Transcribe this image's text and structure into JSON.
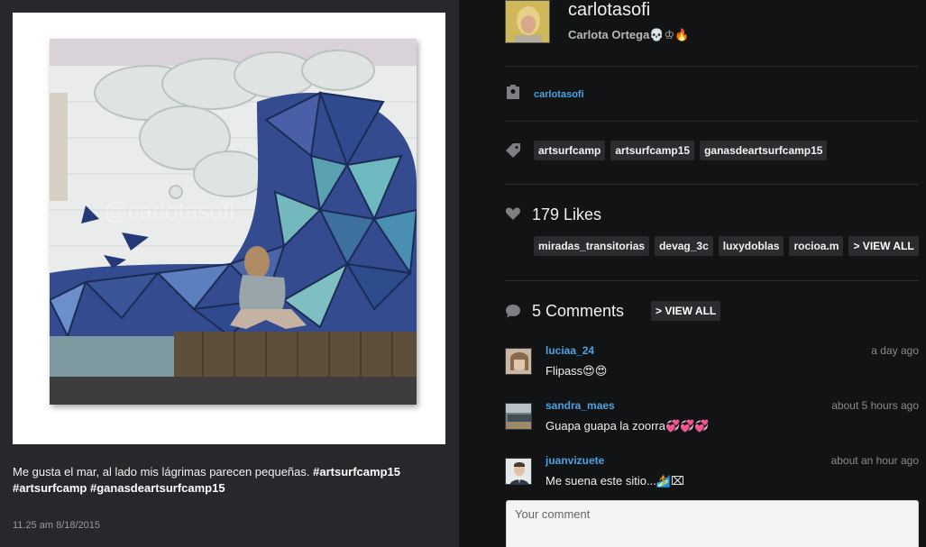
{
  "post": {
    "caption_text": "Me gusta el mar, al lado mis lágrimas parecen pequeñas.",
    "caption_tags": [
      "#artsurfcamp15",
      "#artsurfcamp",
      "#ganasdeartsurfcamp15"
    ],
    "timestamp": "11.25 am 8/18/2015",
    "watermark": "@carlotasofi"
  },
  "profile": {
    "username": "carlotasofi",
    "fullname": "Carlota Ortega💀♔🔥"
  },
  "tagged_user": {
    "icon": "person-badge-icon",
    "name": "carlotasofi"
  },
  "hashtags": {
    "icon": "tag-icon",
    "items": [
      "artsurfcamp",
      "artsurfcamp15",
      "ganasdeartsurfcamp15"
    ]
  },
  "likes": {
    "icon": "heart-icon",
    "count_label": "179 Likes",
    "users": [
      "miradas_transitorias",
      "devag_3c",
      "luxydoblas",
      "rocioa.m"
    ],
    "view_all": "> VIEW ALL"
  },
  "comments": {
    "icon": "speech-bubble-icon",
    "count_label": "5 Comments",
    "view_all": "> VIEW ALL",
    "items": [
      {
        "user": "luciaa_24",
        "time": "a day ago",
        "text": "Flipass😍😍"
      },
      {
        "user": "sandra_maes",
        "time": "about 5 hours ago",
        "text": "Guapa guapa la zoorra💞💞💞"
      },
      {
        "user": "juanvizuete",
        "time": "about an hour ago",
        "text": "Me suena este sitio...🏄⌧"
      }
    ],
    "input_placeholder": "Your comment"
  },
  "colors": {
    "link": "#4aa3df",
    "left_panel_bg": "#26282b",
    "right_panel_bg": "#121314",
    "chip_bg": "#2a2c2f"
  }
}
